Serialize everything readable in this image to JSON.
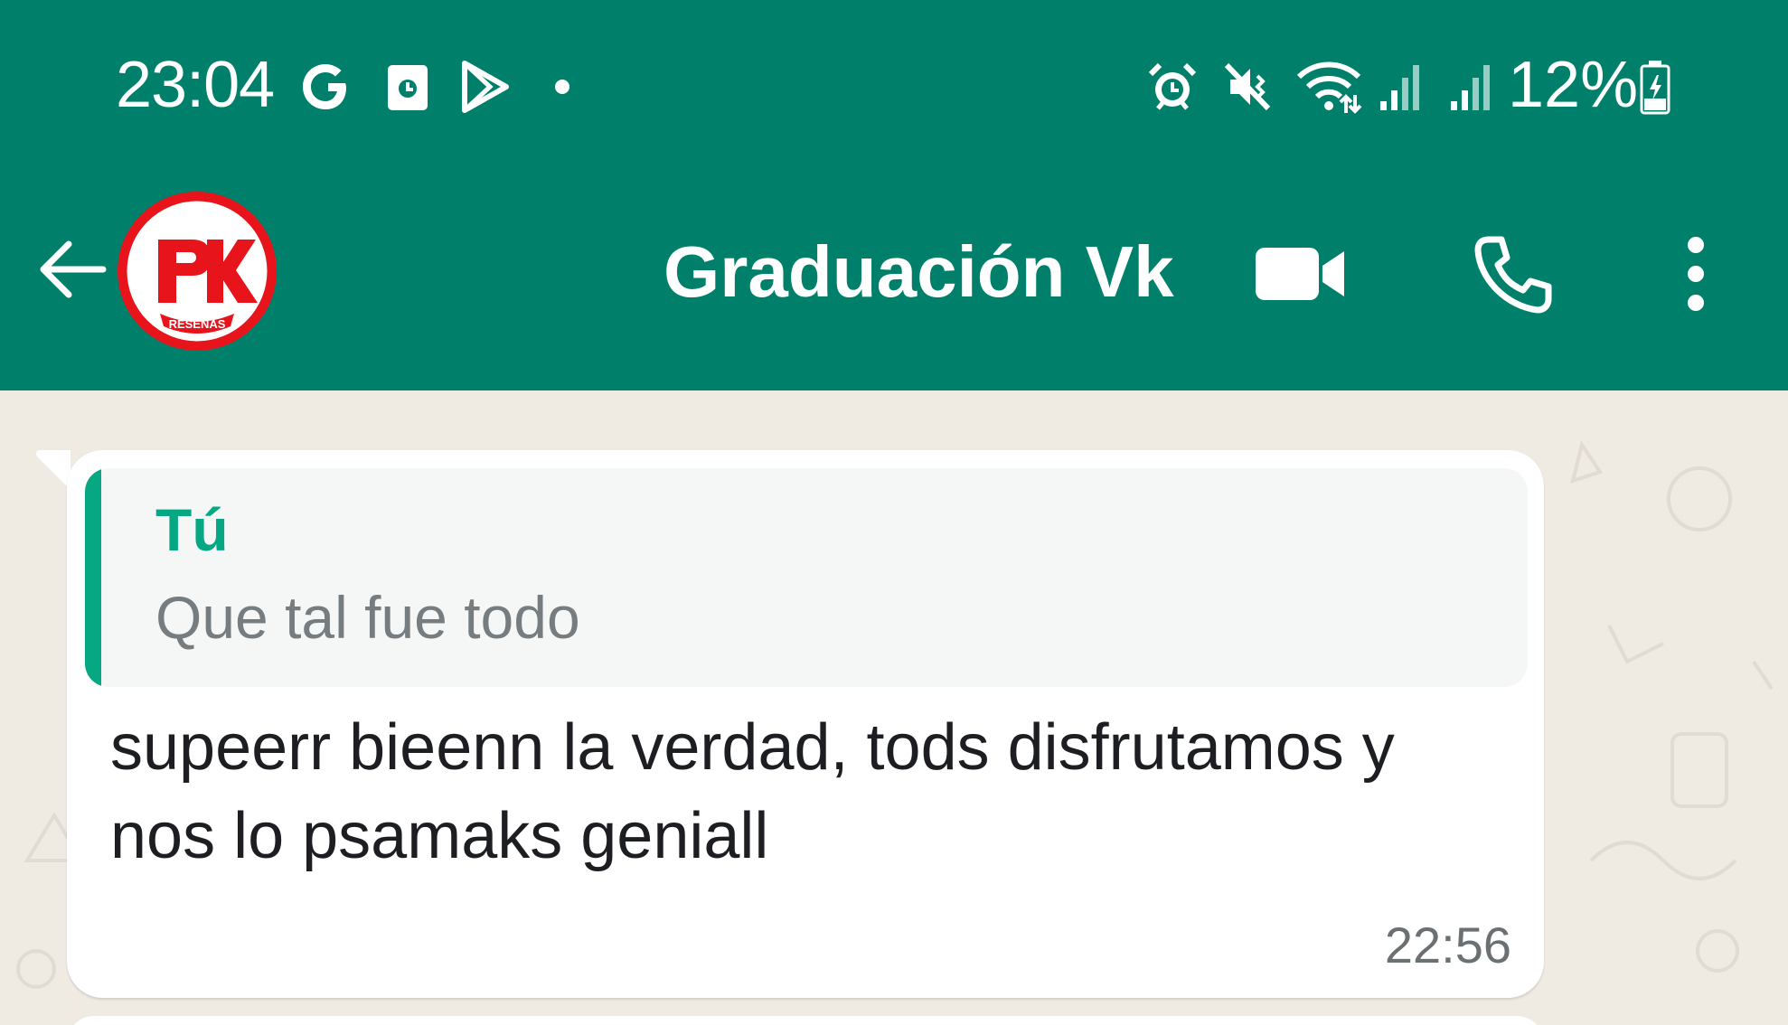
{
  "status_bar": {
    "time": "23:04",
    "notification_icons": [
      "google-g-icon",
      "calendar-app-icon",
      "play-store-icon",
      "more-notifications-dot-icon"
    ],
    "system_icons": [
      "alarm-icon",
      "vibrate-mute-icon",
      "wifi-icon",
      "signal-icon",
      "signal-icon"
    ],
    "battery": "12%"
  },
  "header": {
    "title": "Graduación Vk",
    "avatar_logo_text": "RESEÑAS",
    "avatar_letters": "PK",
    "colors": {
      "bar": "#00806a",
      "avatar": "#e8141b"
    }
  },
  "chat": {
    "messages": [
      {
        "quoted": {
          "author": "Tú",
          "text": "Que tal fue todo"
        },
        "text": "supeerr bieenn la verdad, tods disfrutamos y nos lo psamaks geniall",
        "time": "22:56"
      }
    ],
    "colors": {
      "background": "#efeae2",
      "accent": "#06a884"
    }
  }
}
